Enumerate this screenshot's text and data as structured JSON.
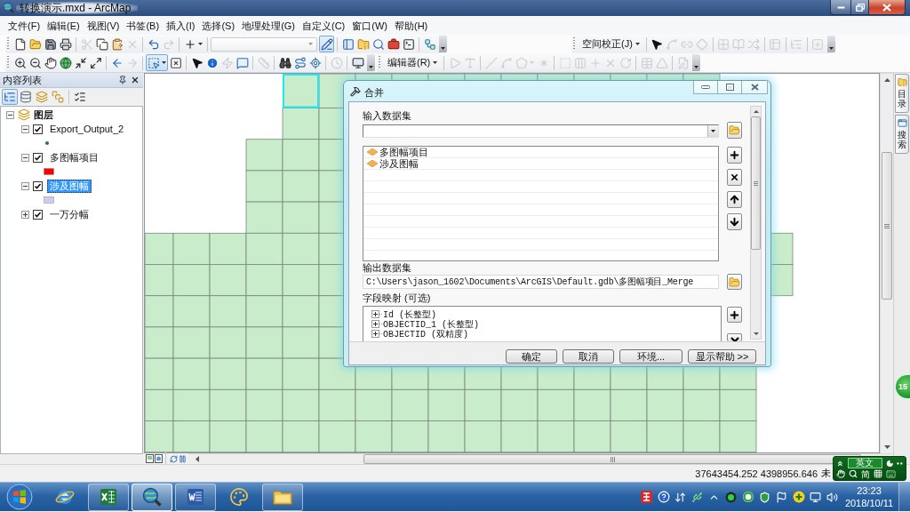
{
  "window": {
    "title": "转换演示.mxd - ArcMap"
  },
  "menu": [
    "文件(F)",
    "编辑(E)",
    "视图(V)",
    "书签(B)",
    "插入(I)",
    "选择(S)",
    "地理处理(G)",
    "自定义(C)",
    "窗口(W)",
    "帮助(H)"
  ],
  "toolbar_rows": [
    {
      "toolbars": [
        {
          "items": [
            {
              "kind": "button",
              "disabled": false,
              "pressed": false
            },
            {
              "kind": "button",
              "disabled": false,
              "pressed": false
            },
            {
              "kind": "button",
              "disabled": false,
              "pressed": false
            },
            {
              "kind": "button",
              "disabled": false,
              "pressed": false
            },
            {
              "kind": "separator"
            },
            {
              "kind": "button",
              "disabled": true,
              "pressed": false
            },
            {
              "kind": "button",
              "disabled": false,
              "pressed": false
            },
            {
              "kind": "button",
              "disabled": false,
              "pressed": false
            },
            {
              "kind": "button",
              "disabled": true,
              "pressed": false
            },
            {
              "kind": "separator"
            },
            {
              "kind": "button",
              "disabled": false,
              "pressed": false
            },
            {
              "kind": "button",
              "disabled": true,
              "pressed": false
            },
            {
              "kind": "separator"
            },
            {
              "kind": "split",
              "disabled": false,
              "pressed": false
            },
            {
              "kind": "separator"
            },
            {
              "kind": "combo"
            },
            {
              "kind": "button",
              "disabled": false,
              "pressed": true
            },
            {
              "kind": "separator"
            },
            {
              "kind": "button",
              "disabled": false,
              "pressed": false
            },
            {
              "kind": "button",
              "disabled": false,
              "pressed": false
            },
            {
              "kind": "button",
              "disabled": false,
              "pressed": false
            },
            {
              "kind": "button",
              "disabled": false,
              "pressed": false
            },
            {
              "kind": "button",
              "disabled": false,
              "pressed": false
            },
            {
              "kind": "separator"
            },
            {
              "kind": "button",
              "disabled": false,
              "pressed": false
            },
            {
              "kind": "overflow"
            }
          ]
        },
        {
          "items": [
            {
              "kind": "menu",
              "label": "空间校正(J)"
            },
            {
              "kind": "separator"
            },
            {
              "kind": "button",
              "disabled": false,
              "pressed": false
            },
            {
              "kind": "button",
              "disabled": true,
              "pressed": false
            },
            {
              "kind": "button",
              "disabled": true,
              "pressed": false
            },
            {
              "kind": "button",
              "disabled": true,
              "pressed": false
            },
            {
              "kind": "separator"
            },
            {
              "kind": "button",
              "disabled": true,
              "pressed": false
            },
            {
              "kind": "button",
              "disabled": true,
              "pressed": false
            },
            {
              "kind": "button",
              "disabled": true,
              "pressed": false
            },
            {
              "kind": "separator"
            },
            {
              "kind": "button",
              "disabled": true,
              "pressed": false
            },
            {
              "kind": "separator"
            },
            {
              "kind": "button",
              "disabled": true,
              "pressed": false
            },
            {
              "kind": "separator"
            },
            {
              "kind": "button",
              "disabled": true,
              "pressed": false
            },
            {
              "kind": "overflow"
            }
          ]
        }
      ]
    },
    {
      "toolbars": [
        {
          "items": [
            {
              "kind": "button",
              "disabled": false,
              "pressed": false
            },
            {
              "kind": "button",
              "disabled": false,
              "pressed": false
            },
            {
              "kind": "button",
              "disabled": false,
              "pressed": false
            },
            {
              "kind": "button",
              "disabled": false,
              "pressed": false
            },
            {
              "kind": "button",
              "disabled": false,
              "pressed": false
            },
            {
              "kind": "button",
              "disabled": false,
              "pressed": false
            },
            {
              "kind": "separator"
            },
            {
              "kind": "button",
              "disabled": false,
              "pressed": false
            },
            {
              "kind": "button",
              "disabled": true,
              "pressed": false
            },
            {
              "kind": "separator"
            },
            {
              "kind": "split",
              "disabled": false,
              "pressed": true
            },
            {
              "kind": "button",
              "disabled": false,
              "pressed": false
            },
            {
              "kind": "separator"
            },
            {
              "kind": "button",
              "disabled": false,
              "pressed": false
            },
            {
              "kind": "button",
              "disabled": false,
              "pressed": false
            },
            {
              "kind": "button",
              "disabled": true,
              "pressed": false
            },
            {
              "kind": "button",
              "disabled": false,
              "pressed": false
            },
            {
              "kind": "separator"
            },
            {
              "kind": "button",
              "disabled": true,
              "pressed": false
            },
            {
              "kind": "separator"
            },
            {
              "kind": "button",
              "disabled": false,
              "pressed": false
            },
            {
              "kind": "button",
              "disabled": false,
              "pressed": false
            },
            {
              "kind": "button",
              "disabled": false,
              "pressed": false
            },
            {
              "kind": "separator"
            },
            {
              "kind": "button",
              "disabled": true,
              "pressed": false
            },
            {
              "kind": "separator"
            },
            {
              "kind": "button",
              "disabled": false,
              "pressed": false
            },
            {
              "kind": "overflow"
            }
          ]
        },
        {
          "items": [
            {
              "kind": "menu",
              "label": "编辑器(R)"
            },
            {
              "kind": "separator"
            },
            {
              "kind": "button",
              "disabled": true,
              "pressed": false
            },
            {
              "kind": "button",
              "disabled": true,
              "pressed": false
            },
            {
              "kind": "separator"
            },
            {
              "kind": "button",
              "disabled": true,
              "pressed": false
            },
            {
              "kind": "button",
              "disabled": true,
              "pressed": false
            },
            {
              "kind": "split",
              "disabled": true,
              "pressed": false
            },
            {
              "kind": "button",
              "disabled": true,
              "pressed": false
            },
            {
              "kind": "separator"
            },
            {
              "kind": "button",
              "disabled": true,
              "pressed": false
            },
            {
              "kind": "button",
              "disabled": true,
              "pressed": false
            },
            {
              "kind": "button",
              "disabled": true,
              "pressed": false
            },
            {
              "kind": "button",
              "disabled": true,
              "pressed": false
            },
            {
              "kind": "button",
              "disabled": true,
              "pressed": false
            },
            {
              "kind": "separator"
            },
            {
              "kind": "button",
              "disabled": true,
              "pressed": false
            },
            {
              "kind": "button",
              "disabled": true,
              "pressed": false
            },
            {
              "kind": "separator"
            },
            {
              "kind": "button",
              "disabled": true,
              "pressed": false
            },
            {
              "kind": "overflow"
            }
          ]
        }
      ]
    }
  ],
  "toc": {
    "title": "内容列表",
    "views": [
      {
        "selected": true
      },
      {
        "selected": false
      },
      {
        "selected": false
      },
      {
        "selected": false
      }
    ],
    "group": {
      "label": "图层",
      "expanded": true,
      "children": [
        {
          "label": "Export_Output_2",
          "expanded": true,
          "checked": true,
          "selected": false,
          "kind": "point",
          "color": "#1e7a32"
        },
        {
          "label": "多图幅项目",
          "expanded": true,
          "checked": true,
          "selected": false,
          "kind": "polygon",
          "color": "#ff0000"
        },
        {
          "label": "涉及图幅",
          "expanded": true,
          "checked": true,
          "selected": true,
          "kind": "polygon",
          "color": "#ccccf0"
        },
        {
          "label": "一万分幅",
          "expanded": false,
          "checked": true,
          "selected": false
        }
      ]
    }
  },
  "side_tabs": [
    "目录",
    "搜索"
  ],
  "dialog": {
    "title": "合并",
    "input_label": "输入数据集",
    "input_items": [
      "多图幅项目",
      "涉及图幅"
    ],
    "output_label": "输出数据集",
    "output_path": "C:\\Users\\jason_1602\\Documents\\ArcGIS\\Default.gdb\\多图幅项目_Merge",
    "field_map_label": "字段映射 (可选)",
    "fields": [
      {
        "label": "Id (长整型)",
        "expanded": false
      },
      {
        "label": "OBJECTID_1 (长整型)",
        "expanded": false
      },
      {
        "label": "OBJECTID (双精度)",
        "expanded": false
      }
    ],
    "buttons": [
      "确定",
      "取消",
      "环境...",
      "显示帮助 >>"
    ]
  },
  "status_bar": {
    "coordinates": "37643454.252 4398956.646",
    "unit": "未"
  },
  "ime": {
    "mode": "英文",
    "script": "简"
  },
  "speed_ball": {
    "value": "15"
  },
  "taskbar": {
    "apps": [
      {
        "running": false,
        "selected": false
      },
      {
        "running": true,
        "selected": false
      },
      {
        "running": true,
        "selected": true
      },
      {
        "running": true,
        "selected": false
      },
      {
        "running": false,
        "selected": false
      },
      {
        "running": true,
        "selected": false
      }
    ],
    "time": "23:23",
    "date": "2018/10/11"
  }
}
